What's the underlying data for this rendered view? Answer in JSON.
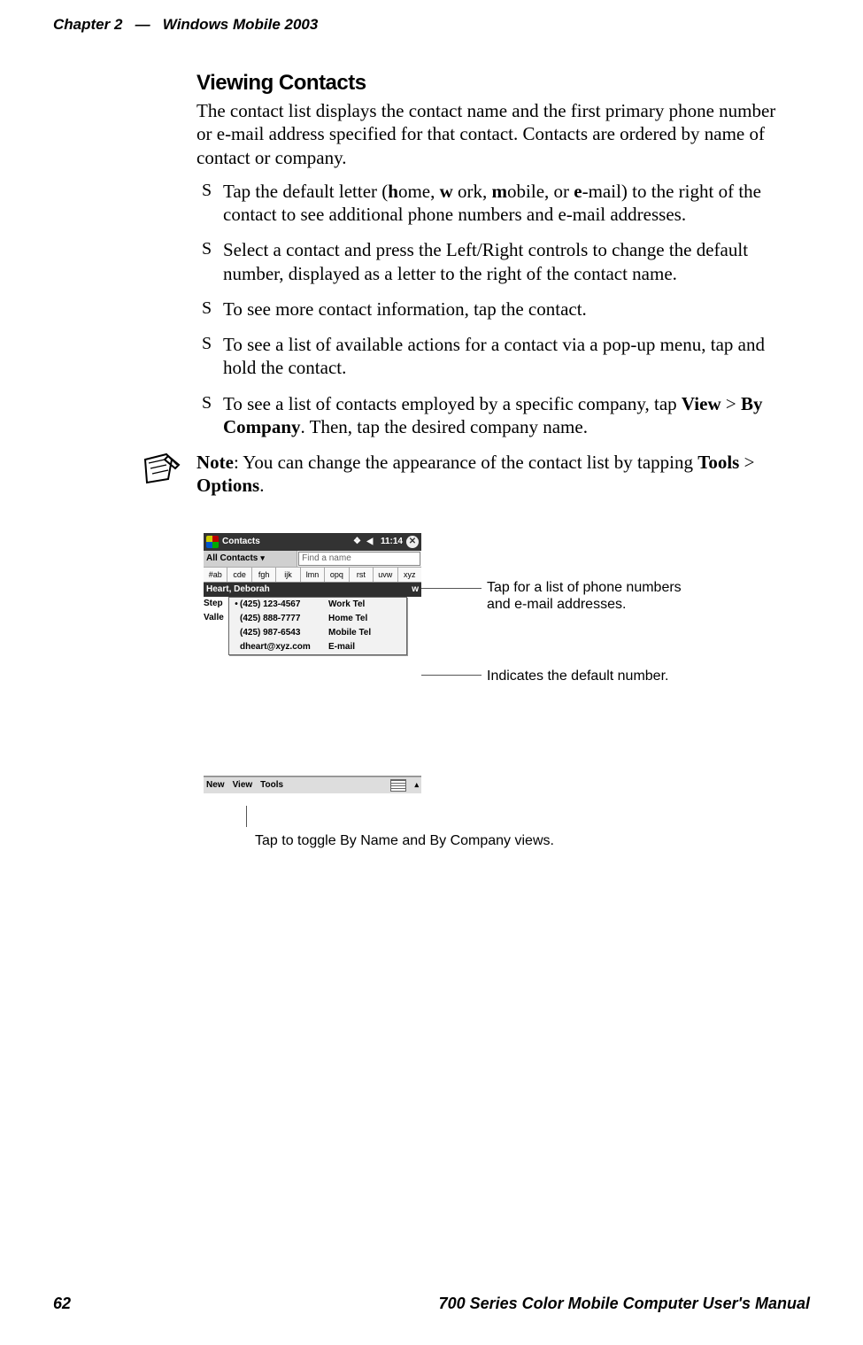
{
  "header": {
    "chapter_label": "Chapter 2",
    "dash": "—",
    "chapter_title": "Windows Mobile 2003"
  },
  "heading": "Viewing Contacts",
  "intro": "The contact list displays the contact name and the first primary phone number or e-mail address specified for that contact. Contacts are ordered by name of contact or company.",
  "bullets": {
    "b1_pre": "Tap the default letter (",
    "b1_h": "h",
    "b1_home": "ome, ",
    "b1_w": "w",
    "b1_work": " ork, ",
    "b1_m": "m",
    "b1_mobile": "obile, or ",
    "b1_e": "e",
    "b1_email": "-mail) to the right of the contact to see additional phone numbers and e-mail addresses.",
    "b2": "Select a contact and press the Left/Right controls to change the default number, displayed as a letter to the right of the contact name.",
    "b3": "To see more contact information, tap the contact.",
    "b4": "To see a list of available actions for a contact via a pop-up menu, tap and hold the contact.",
    "b5_pre": "To see a list of contacts employed by a specific company, tap ",
    "b5_view": "View",
    "b5_gt": " > ",
    "b5_by_company": "By Company",
    "b5_post": ". Then, tap the desired company name."
  },
  "note": {
    "label": "Note",
    "pre": ": You can change the appearance of the contact list by tapping ",
    "tools": "Tools",
    "gt": " > ",
    "options": "Options",
    "post": "."
  },
  "device": {
    "title": "Contacts",
    "time": "11:14",
    "category": "All Contacts",
    "find_placeholder": "Find a name",
    "tabs": [
      "#ab",
      "cde",
      "fgh",
      "ijk",
      "lmn",
      "opq",
      "rst",
      "uvw",
      "xyz"
    ],
    "selected_name": "Heart, Deborah",
    "selected_letter": "w",
    "clipped1": "Step",
    "clipped2": "Valle",
    "popup": [
      {
        "dot": "•",
        "value": "(425) 123-4567",
        "label": "Work Tel"
      },
      {
        "dot": "",
        "value": "(425) 888-7777",
        "label": "Home Tel"
      },
      {
        "dot": "",
        "value": "(425) 987-6543",
        "label": "Mobile Tel"
      },
      {
        "dot": "",
        "value": "dheart@xyz.com",
        "label": "E-mail"
      }
    ],
    "cmd_new": "New",
    "cmd_view": "View",
    "cmd_tools": "Tools"
  },
  "callouts": {
    "c1": "Tap for a list of phone numbers and e-mail addresses.",
    "c2": "Indicates the default number.",
    "c3": "Tap to toggle By Name and By Company views."
  },
  "footer": {
    "pagenum": "62",
    "title": "700 Series Color Mobile Computer User's Manual"
  }
}
